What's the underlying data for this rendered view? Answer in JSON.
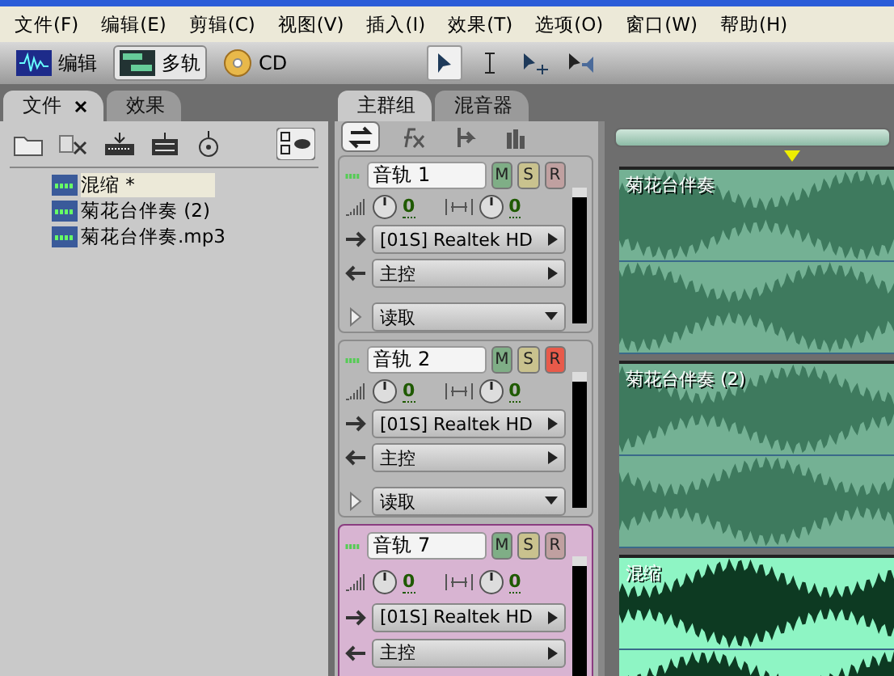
{
  "menu": [
    "文件(F)",
    "编辑(E)",
    "剪辑(C)",
    "视图(V)",
    "插入(I)",
    "效果(T)",
    "选项(O)",
    "窗口(W)",
    "帮助(H)"
  ],
  "toolbar": {
    "modes": [
      {
        "kind": "edit",
        "label": "编辑",
        "selected": false
      },
      {
        "kind": "multitrack",
        "label": "多轨",
        "selected": true
      },
      {
        "kind": "cd",
        "label": "CD",
        "selected": false
      }
    ],
    "tools": [
      {
        "kind": "select",
        "selected": true
      },
      {
        "kind": "time",
        "selected": false
      },
      {
        "kind": "move",
        "selected": false
      },
      {
        "kind": "scrub",
        "selected": false
      }
    ]
  },
  "files_panel": {
    "tabs": [
      {
        "label": "文件",
        "selected": true,
        "closable": true
      },
      {
        "label": "效果",
        "selected": false,
        "closable": false
      }
    ],
    "items": [
      {
        "name": "混缩 *",
        "selected": true
      },
      {
        "name": "菊花台伴奏 (2)",
        "selected": false
      },
      {
        "name": "菊花台伴奏.mp3",
        "selected": false
      }
    ]
  },
  "session_panel": {
    "tabs": [
      {
        "label": "主群组",
        "selected": true
      },
      {
        "label": "混音器",
        "selected": false
      }
    ],
    "view_buttons": [
      {
        "kind": "inout",
        "selected": true
      },
      {
        "kind": "fx",
        "selected": false
      },
      {
        "kind": "sends",
        "selected": false
      },
      {
        "kind": "eq",
        "selected": false
      }
    ],
    "tracks": [
      {
        "name": "音轨 1",
        "volume": "0",
        "pan": "0",
        "output": "[01S] Realtek HD",
        "input": "主控",
        "automation": "读取",
        "buttons": [
          {
            "kind": "mute",
            "label": "M",
            "on": false
          },
          {
            "kind": "solo",
            "label": "S",
            "on": false
          },
          {
            "kind": "record",
            "label": "R",
            "on": false
          }
        ],
        "selected": false,
        "clip": {
          "name": "菊花台伴奏",
          "selected": false
        }
      },
      {
        "name": "音轨 2",
        "volume": "0",
        "pan": "0",
        "output": "[01S] Realtek HD",
        "input": "主控",
        "automation": "读取",
        "buttons": [
          {
            "kind": "mute",
            "label": "M",
            "on": false
          },
          {
            "kind": "solo",
            "label": "S",
            "on": false
          },
          {
            "kind": "record",
            "label": "R",
            "on": true
          }
        ],
        "selected": false,
        "clip": {
          "name": "菊花台伴奏 (2)",
          "selected": false
        }
      },
      {
        "name": "音轨 7",
        "volume": "0",
        "pan": "0",
        "output": "[01S] Realtek HD",
        "input": "主控",
        "buttons": [
          {
            "kind": "mute",
            "label": "M",
            "on": false
          },
          {
            "kind": "solo",
            "label": "S",
            "on": false
          },
          {
            "kind": "record",
            "label": "R",
            "on": false
          }
        ],
        "selected": true,
        "clip": {
          "name": "混缩",
          "selected": true
        }
      }
    ]
  }
}
